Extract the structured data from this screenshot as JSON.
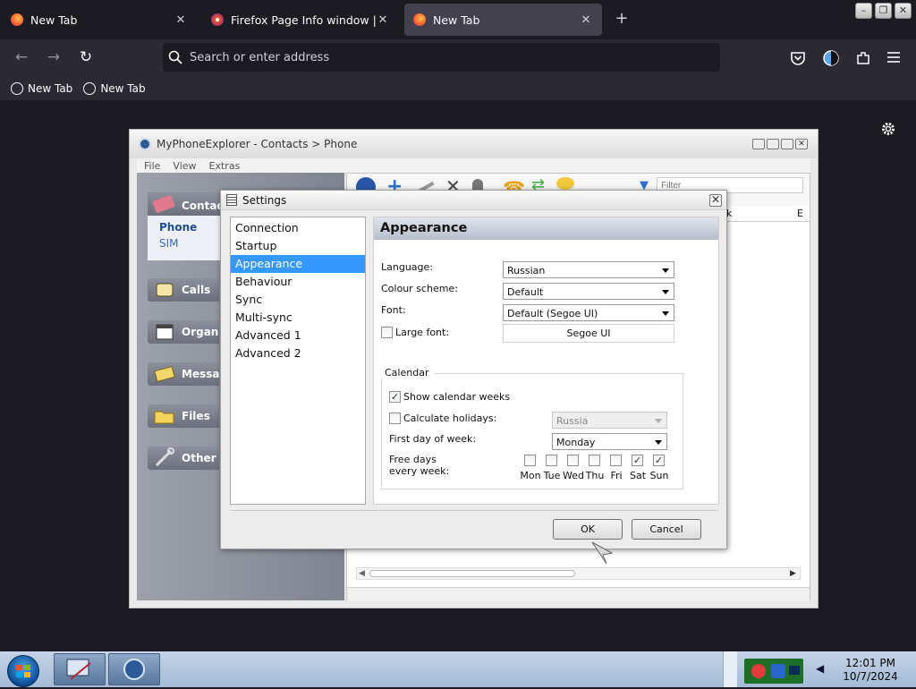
{
  "browser": {
    "tabs": [
      {
        "title": "New Tab",
        "active": false
      },
      {
        "title": "Firefox Page Info window | Firef",
        "active": false
      },
      {
        "title": "New Tab",
        "active": true
      }
    ],
    "url_placeholder": "Search or enter address",
    "bookmarks": [
      "New Tab",
      "New Tab"
    ]
  },
  "app": {
    "title": "MyPhoneExplorer -  Contacts > Phone",
    "menu": [
      "File",
      "View",
      "Extras"
    ],
    "sidebar": {
      "contacts_label": "Contacts",
      "contacts_sub": [
        "Phone",
        "SIM"
      ],
      "items": [
        "Calls",
        "Organizer",
        "Messages",
        "Files",
        "Other"
      ]
    },
    "filter_placeholder": "Filter",
    "col_headers": [
      "k",
      "E"
    ]
  },
  "dialog": {
    "title": "Settings",
    "nav": [
      "Connection",
      "Startup",
      "Appearance",
      "Behaviour",
      "Sync",
      "Multi-sync",
      "Advanced 1",
      "Advanced 2"
    ],
    "selected_nav": "Appearance",
    "panel_title": "Appearance",
    "language_label": "Language:",
    "language_value": "Russian",
    "colour_label": "Colour scheme:",
    "colour_value": "Default",
    "font_label": "Font:",
    "font_value": "Default (Segoe UI)",
    "large_font_label": "Large font:",
    "large_font_checked": false,
    "font_preview": "Segoe UI",
    "calendar": {
      "group_label": "Calendar",
      "show_weeks_label": "Show calendar weeks",
      "show_weeks_checked": true,
      "holidays_label": "Calculate holidays:",
      "holidays_checked": false,
      "holidays_value": "Russia",
      "first_day_label": "First day of week:",
      "first_day_value": "Monday",
      "free_days_label_1": "Free days",
      "free_days_label_2": "every week:",
      "days": [
        {
          "label": "Mon",
          "checked": false
        },
        {
          "label": "Tue",
          "checked": false
        },
        {
          "label": "Wed",
          "checked": false
        },
        {
          "label": "Thu",
          "checked": false
        },
        {
          "label": "Fri",
          "checked": false
        },
        {
          "label": "Sat",
          "checked": true
        },
        {
          "label": "Sun",
          "checked": true
        }
      ]
    },
    "ok_label": "OK",
    "cancel_label": "Cancel"
  },
  "taskbar": {
    "time": "12:01 PM",
    "date": "10/7/2024"
  }
}
